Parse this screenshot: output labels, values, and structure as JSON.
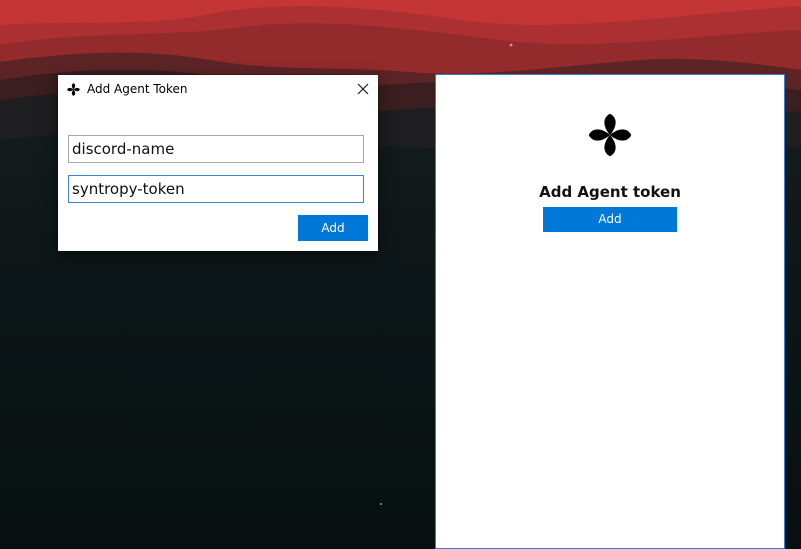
{
  "dialog": {
    "title": "Add Agent Token",
    "title_icon": "clover-icon",
    "close_icon": "close-icon",
    "name_field_value": "discord-name",
    "token_field_value": "syntropy-token",
    "add_label": "Add"
  },
  "panel": {
    "logo_icon": "clover-icon",
    "heading": "Add Agent token",
    "add_label": "Add"
  },
  "colors": {
    "accent": "#0078d7",
    "focus_border": "#3a84c9",
    "panel_border": "#3b7dc8",
    "sky_red": "#b52f31",
    "mountain_dark": "#0a1416"
  }
}
